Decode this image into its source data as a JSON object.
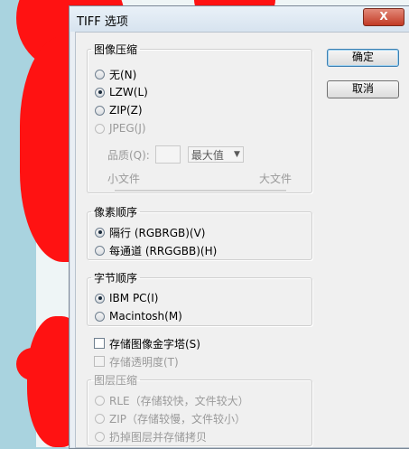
{
  "dialog": {
    "title": "TIFF 选项",
    "close_label": "X"
  },
  "buttons": {
    "ok": "确定",
    "cancel": "取消"
  },
  "image_compression": {
    "legend": "图像压缩",
    "options": [
      {
        "label": "无(N)",
        "checked": false,
        "disabled": false
      },
      {
        "label": "LZW(L)",
        "checked": true,
        "disabled": false
      },
      {
        "label": "ZIP(Z)",
        "checked": false,
        "disabled": false
      },
      {
        "label": "JPEG(J)",
        "checked": false,
        "disabled": true
      }
    ],
    "quality_label": "品质(Q):",
    "quality_select": "最大值",
    "small_file": "小文件",
    "large_file": "大文件"
  },
  "pixel_order": {
    "legend": "像素顺序",
    "options": [
      {
        "label": "隔行 (RGBRGB)(V)",
        "checked": true
      },
      {
        "label": "每通道 (RRGGBB)(H)",
        "checked": false
      }
    ]
  },
  "byte_order": {
    "legend": "字节顺序",
    "options": [
      {
        "label": "IBM PC(I)",
        "checked": true
      },
      {
        "label": "Macintosh(M)",
        "checked": false
      }
    ]
  },
  "save_pyramid": "存储图像金字塔(S)",
  "save_transparency": "存储透明度(T)",
  "layer_compression": {
    "legend": "图层压缩",
    "options": [
      {
        "label": "RLE（存储较快，文件较大）"
      },
      {
        "label": "ZIP（存储较慢，文件较小）"
      },
      {
        "label": "扔掉图层并存储拷贝"
      }
    ]
  },
  "colors": {
    "background_red": "#ff1212",
    "background_blue": "#a9d3df"
  }
}
